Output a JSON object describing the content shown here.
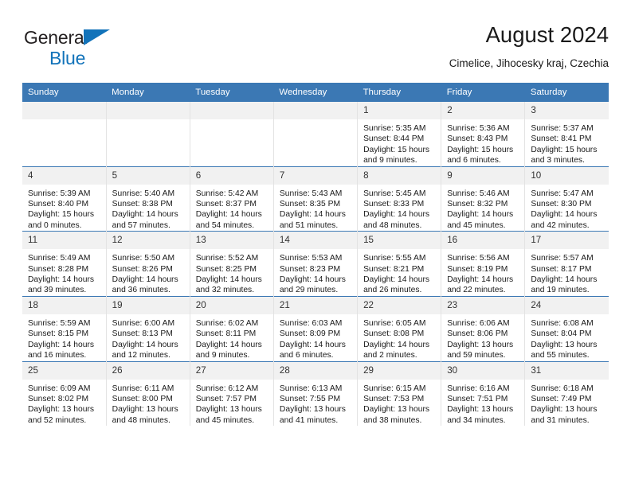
{
  "brand": {
    "name_part1": "General",
    "name_part2": "Blue",
    "triangle_icon": "triangle-icon",
    "color_dark": "#231f20",
    "color_blue": "#1273ba"
  },
  "header": {
    "title": "August 2024",
    "subtitle": "Cimelice, Jihocesky kraj, Czechia"
  },
  "theme": {
    "header_blue": "#3b78b4",
    "daynum_band": "#f1f1f1",
    "cell_border": "#e3e3e3"
  },
  "calendar": {
    "weekday_headers": [
      "Sunday",
      "Monday",
      "Tuesday",
      "Wednesday",
      "Thursday",
      "Friday",
      "Saturday"
    ],
    "weeks": [
      [
        {
          "day": "",
          "empty": true,
          "sunrise": "",
          "sunset": "",
          "daylight_line1": "",
          "daylight_line2": ""
        },
        {
          "day": "",
          "empty": true,
          "sunrise": "",
          "sunset": "",
          "daylight_line1": "",
          "daylight_line2": ""
        },
        {
          "day": "",
          "empty": true,
          "sunrise": "",
          "sunset": "",
          "daylight_line1": "",
          "daylight_line2": ""
        },
        {
          "day": "",
          "empty": true,
          "sunrise": "",
          "sunset": "",
          "daylight_line1": "",
          "daylight_line2": ""
        },
        {
          "day": "1",
          "empty": false,
          "sunrise": "Sunrise: 5:35 AM",
          "sunset": "Sunset: 8:44 PM",
          "daylight_line1": "Daylight: 15 hours",
          "daylight_line2": "and 9 minutes."
        },
        {
          "day": "2",
          "empty": false,
          "sunrise": "Sunrise: 5:36 AM",
          "sunset": "Sunset: 8:43 PM",
          "daylight_line1": "Daylight: 15 hours",
          "daylight_line2": "and 6 minutes."
        },
        {
          "day": "3",
          "empty": false,
          "sunrise": "Sunrise: 5:37 AM",
          "sunset": "Sunset: 8:41 PM",
          "daylight_line1": "Daylight: 15 hours",
          "daylight_line2": "and 3 minutes."
        }
      ],
      [
        {
          "day": "4",
          "empty": false,
          "sunrise": "Sunrise: 5:39 AM",
          "sunset": "Sunset: 8:40 PM",
          "daylight_line1": "Daylight: 15 hours",
          "daylight_line2": "and 0 minutes."
        },
        {
          "day": "5",
          "empty": false,
          "sunrise": "Sunrise: 5:40 AM",
          "sunset": "Sunset: 8:38 PM",
          "daylight_line1": "Daylight: 14 hours",
          "daylight_line2": "and 57 minutes."
        },
        {
          "day": "6",
          "empty": false,
          "sunrise": "Sunrise: 5:42 AM",
          "sunset": "Sunset: 8:37 PM",
          "daylight_line1": "Daylight: 14 hours",
          "daylight_line2": "and 54 minutes."
        },
        {
          "day": "7",
          "empty": false,
          "sunrise": "Sunrise: 5:43 AM",
          "sunset": "Sunset: 8:35 PM",
          "daylight_line1": "Daylight: 14 hours",
          "daylight_line2": "and 51 minutes."
        },
        {
          "day": "8",
          "empty": false,
          "sunrise": "Sunrise: 5:45 AM",
          "sunset": "Sunset: 8:33 PM",
          "daylight_line1": "Daylight: 14 hours",
          "daylight_line2": "and 48 minutes."
        },
        {
          "day": "9",
          "empty": false,
          "sunrise": "Sunrise: 5:46 AM",
          "sunset": "Sunset: 8:32 PM",
          "daylight_line1": "Daylight: 14 hours",
          "daylight_line2": "and 45 minutes."
        },
        {
          "day": "10",
          "empty": false,
          "sunrise": "Sunrise: 5:47 AM",
          "sunset": "Sunset: 8:30 PM",
          "daylight_line1": "Daylight: 14 hours",
          "daylight_line2": "and 42 minutes."
        }
      ],
      [
        {
          "day": "11",
          "empty": false,
          "sunrise": "Sunrise: 5:49 AM",
          "sunset": "Sunset: 8:28 PM",
          "daylight_line1": "Daylight: 14 hours",
          "daylight_line2": "and 39 minutes."
        },
        {
          "day": "12",
          "empty": false,
          "sunrise": "Sunrise: 5:50 AM",
          "sunset": "Sunset: 8:26 PM",
          "daylight_line1": "Daylight: 14 hours",
          "daylight_line2": "and 36 minutes."
        },
        {
          "day": "13",
          "empty": false,
          "sunrise": "Sunrise: 5:52 AM",
          "sunset": "Sunset: 8:25 PM",
          "daylight_line1": "Daylight: 14 hours",
          "daylight_line2": "and 32 minutes."
        },
        {
          "day": "14",
          "empty": false,
          "sunrise": "Sunrise: 5:53 AM",
          "sunset": "Sunset: 8:23 PM",
          "daylight_line1": "Daylight: 14 hours",
          "daylight_line2": "and 29 minutes."
        },
        {
          "day": "15",
          "empty": false,
          "sunrise": "Sunrise: 5:55 AM",
          "sunset": "Sunset: 8:21 PM",
          "daylight_line1": "Daylight: 14 hours",
          "daylight_line2": "and 26 minutes."
        },
        {
          "day": "16",
          "empty": false,
          "sunrise": "Sunrise: 5:56 AM",
          "sunset": "Sunset: 8:19 PM",
          "daylight_line1": "Daylight: 14 hours",
          "daylight_line2": "and 22 minutes."
        },
        {
          "day": "17",
          "empty": false,
          "sunrise": "Sunrise: 5:57 AM",
          "sunset": "Sunset: 8:17 PM",
          "daylight_line1": "Daylight: 14 hours",
          "daylight_line2": "and 19 minutes."
        }
      ],
      [
        {
          "day": "18",
          "empty": false,
          "sunrise": "Sunrise: 5:59 AM",
          "sunset": "Sunset: 8:15 PM",
          "daylight_line1": "Daylight: 14 hours",
          "daylight_line2": "and 16 minutes."
        },
        {
          "day": "19",
          "empty": false,
          "sunrise": "Sunrise: 6:00 AM",
          "sunset": "Sunset: 8:13 PM",
          "daylight_line1": "Daylight: 14 hours",
          "daylight_line2": "and 12 minutes."
        },
        {
          "day": "20",
          "empty": false,
          "sunrise": "Sunrise: 6:02 AM",
          "sunset": "Sunset: 8:11 PM",
          "daylight_line1": "Daylight: 14 hours",
          "daylight_line2": "and 9 minutes."
        },
        {
          "day": "21",
          "empty": false,
          "sunrise": "Sunrise: 6:03 AM",
          "sunset": "Sunset: 8:09 PM",
          "daylight_line1": "Daylight: 14 hours",
          "daylight_line2": "and 6 minutes."
        },
        {
          "day": "22",
          "empty": false,
          "sunrise": "Sunrise: 6:05 AM",
          "sunset": "Sunset: 8:08 PM",
          "daylight_line1": "Daylight: 14 hours",
          "daylight_line2": "and 2 minutes."
        },
        {
          "day": "23",
          "empty": false,
          "sunrise": "Sunrise: 6:06 AM",
          "sunset": "Sunset: 8:06 PM",
          "daylight_line1": "Daylight: 13 hours",
          "daylight_line2": "and 59 minutes."
        },
        {
          "day": "24",
          "empty": false,
          "sunrise": "Sunrise: 6:08 AM",
          "sunset": "Sunset: 8:04 PM",
          "daylight_line1": "Daylight: 13 hours",
          "daylight_line2": "and 55 minutes."
        }
      ],
      [
        {
          "day": "25",
          "empty": false,
          "sunrise": "Sunrise: 6:09 AM",
          "sunset": "Sunset: 8:02 PM",
          "daylight_line1": "Daylight: 13 hours",
          "daylight_line2": "and 52 minutes."
        },
        {
          "day": "26",
          "empty": false,
          "sunrise": "Sunrise: 6:11 AM",
          "sunset": "Sunset: 8:00 PM",
          "daylight_line1": "Daylight: 13 hours",
          "daylight_line2": "and 48 minutes."
        },
        {
          "day": "27",
          "empty": false,
          "sunrise": "Sunrise: 6:12 AM",
          "sunset": "Sunset: 7:57 PM",
          "daylight_line1": "Daylight: 13 hours",
          "daylight_line2": "and 45 minutes."
        },
        {
          "day": "28",
          "empty": false,
          "sunrise": "Sunrise: 6:13 AM",
          "sunset": "Sunset: 7:55 PM",
          "daylight_line1": "Daylight: 13 hours",
          "daylight_line2": "and 41 minutes."
        },
        {
          "day": "29",
          "empty": false,
          "sunrise": "Sunrise: 6:15 AM",
          "sunset": "Sunset: 7:53 PM",
          "daylight_line1": "Daylight: 13 hours",
          "daylight_line2": "and 38 minutes."
        },
        {
          "day": "30",
          "empty": false,
          "sunrise": "Sunrise: 6:16 AM",
          "sunset": "Sunset: 7:51 PM",
          "daylight_line1": "Daylight: 13 hours",
          "daylight_line2": "and 34 minutes."
        },
        {
          "day": "31",
          "empty": false,
          "sunrise": "Sunrise: 6:18 AM",
          "sunset": "Sunset: 7:49 PM",
          "daylight_line1": "Daylight: 13 hours",
          "daylight_line2": "and 31 minutes."
        }
      ]
    ]
  }
}
